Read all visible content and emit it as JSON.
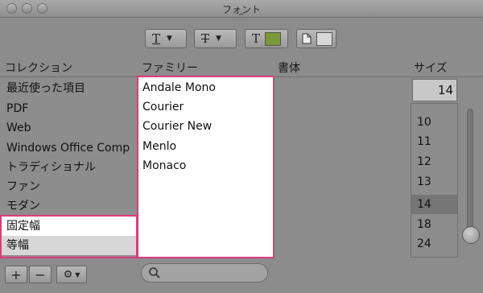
{
  "window": {
    "title": "フォント"
  },
  "toolbar": {
    "underline_glyph": "T",
    "strike_glyph": "T",
    "text_color_glyph": "T",
    "text_color": "#7a9a3a",
    "doc_color": "#d8d8d8"
  },
  "headers": {
    "collection": "コレクション",
    "family": "ファミリー",
    "typeface": "書体",
    "size": "サイズ"
  },
  "collections": [
    "最近使った項目",
    "PDF",
    "Web",
    "Windows Office Comp",
    "トラディショナル",
    "ファン",
    "モダン",
    "固定幅",
    "等幅"
  ],
  "families": [
    "Andale Mono",
    "Courier",
    "Courier New",
    "Menlo",
    "Monaco"
  ],
  "size": {
    "value": "14",
    "list": [
      "10",
      "11",
      "12",
      "13",
      "14",
      "18",
      "24"
    ],
    "selected": "14"
  },
  "colors": {
    "highlight": "#e03a7a"
  }
}
